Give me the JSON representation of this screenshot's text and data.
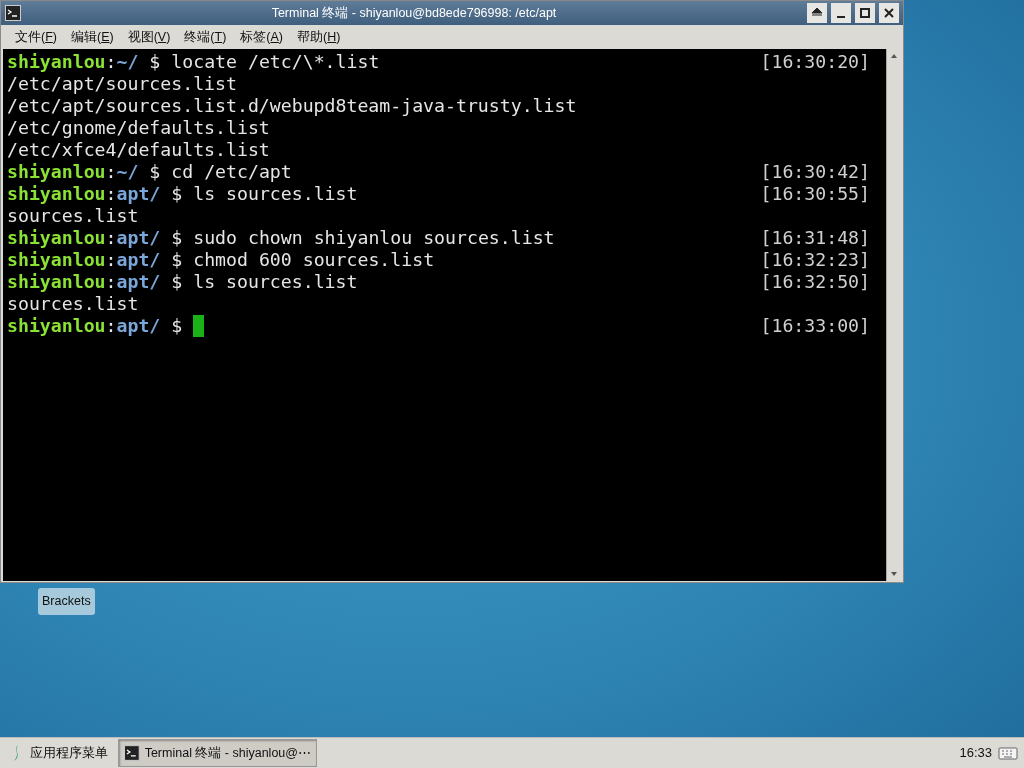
{
  "window": {
    "title": "Terminal 终端 - shiyanlou@bd8ede796998: /etc/apt"
  },
  "menu": [
    {
      "label": "文件(F)"
    },
    {
      "label": "编辑(E)"
    },
    {
      "label": "视图(V)"
    },
    {
      "label": "终端(T)"
    },
    {
      "label": "标签(A)"
    },
    {
      "label": "帮助(H)"
    }
  ],
  "terminal": {
    "lines": [
      {
        "kind": "prompt",
        "user": "shiyanlou",
        "sep": ":",
        "path": "~/",
        "symbol": "$",
        "command": "locate /etc/\\*.list",
        "time": "[16:30:20]"
      },
      {
        "kind": "output",
        "text": "/etc/apt/sources.list"
      },
      {
        "kind": "output",
        "text": "/etc/apt/sources.list.d/webupd8team-java-trusty.list"
      },
      {
        "kind": "output",
        "text": "/etc/gnome/defaults.list"
      },
      {
        "kind": "output",
        "text": "/etc/xfce4/defaults.list"
      },
      {
        "kind": "prompt",
        "user": "shiyanlou",
        "sep": ":",
        "path": "~/",
        "symbol": "$",
        "command": "cd /etc/apt",
        "time": "[16:30:42]"
      },
      {
        "kind": "prompt",
        "user": "shiyanlou",
        "sep": ":",
        "path": "apt/",
        "symbol": "$",
        "command": "ls sources.list",
        "time": "[16:30:55]"
      },
      {
        "kind": "output",
        "text": "sources.list"
      },
      {
        "kind": "prompt",
        "user": "shiyanlou",
        "sep": ":",
        "path": "apt/",
        "symbol": "$",
        "command": "sudo chown shiyanlou sources.list",
        "time": "[16:31:48]"
      },
      {
        "kind": "prompt",
        "user": "shiyanlou",
        "sep": ":",
        "path": "apt/",
        "symbol": "$",
        "command": "chmod 600 sources.list",
        "time": "[16:32:23]"
      },
      {
        "kind": "prompt",
        "user": "shiyanlou",
        "sep": ":",
        "path": "apt/",
        "symbol": "$",
        "command": "ls sources.list",
        "time": "[16:32:50]"
      },
      {
        "kind": "output",
        "text": "sources.list"
      },
      {
        "kind": "prompt",
        "user": "shiyanlou",
        "sep": ":",
        "path": "apt/",
        "symbol": "$",
        "time": "[16:33:00]",
        "cursor": true
      }
    ]
  },
  "desktop": {
    "icons": [
      {
        "label": "Brackets"
      }
    ]
  },
  "taskbar": {
    "apps_menu": "应用程序菜单",
    "tasks": [
      {
        "label": "Terminal 终端 - shiyanlou@⋯",
        "selected": true
      }
    ],
    "clock": "16:33"
  }
}
